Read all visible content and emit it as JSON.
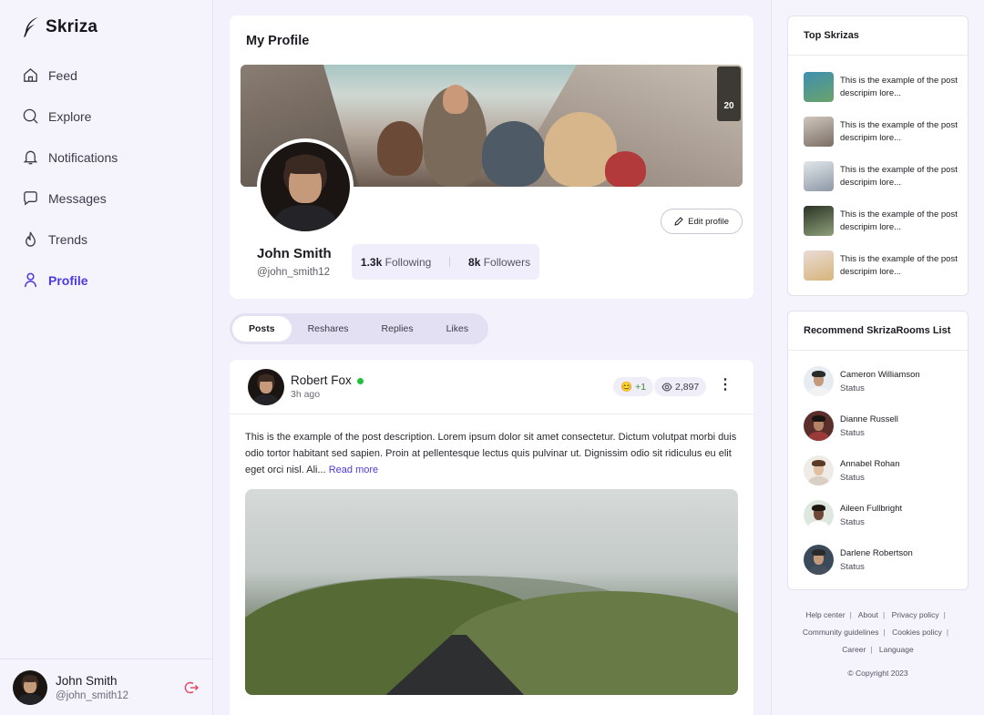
{
  "app": {
    "name": "Skriza"
  },
  "nav": [
    {
      "label": "Feed",
      "icon": "home-icon"
    },
    {
      "label": "Explore",
      "icon": "search-icon"
    },
    {
      "label": "Notifications",
      "icon": "bell-icon"
    },
    {
      "label": "Messages",
      "icon": "message-icon"
    },
    {
      "label": "Trends",
      "icon": "flame-icon"
    },
    {
      "label": "Profile",
      "icon": "user-icon",
      "active": true
    }
  ],
  "current_user": {
    "name": "John Smith",
    "handle": "@john_smith12"
  },
  "profile": {
    "section_title": "My Profile",
    "name": "John Smith",
    "handle": "@john_smith12",
    "edit_label": "Edit profile",
    "following_count": "1.3k",
    "following_label": "Following",
    "followers_count": "8k",
    "followers_label": "Followers",
    "cover_sign": "20"
  },
  "tabs": [
    "Posts",
    "Reshares",
    "Replies",
    "Likes"
  ],
  "post": {
    "author": "Robert Fox",
    "time": "3h ago",
    "reaction": "+1",
    "reaction_emoji": "😊",
    "views": "2,897",
    "text": "This is the example of the post description. Lorem ipsum dolor sit amet consectetur. Dictum volutpat morbi duis odio tortor habitant sed sapien. Proin at pellentesque lectus quis pulvinar ut. Dignissim odio sit ridiculus eu elit eget orci nisl. Ali...",
    "read_more": "Read more"
  },
  "top_skrizas": {
    "title": "Top Skrizas",
    "items": [
      {
        "text": "This is the example of the post descripim lore...",
        "color": "#3f8fb0"
      },
      {
        "text": "This is the example of the post descripim lore...",
        "color": "#9a8f86"
      },
      {
        "text": "This is the example of the post descripim lore...",
        "color": "#b9c2cc"
      },
      {
        "text": "This is the example of the post descripim lore...",
        "color": "#4d5a3a"
      },
      {
        "text": "This is the example of the post descripim lore...",
        "color": "#e0cfc8"
      }
    ]
  },
  "rooms": {
    "title": "Recommend SkrizaRooms List",
    "items": [
      {
        "name": "Cameron Williamson",
        "status": "Status"
      },
      {
        "name": "Dianne Russell",
        "status": "Status"
      },
      {
        "name": "Annabel Rohan",
        "status": "Status"
      },
      {
        "name": "Aileen Fullbright",
        "status": "Status"
      },
      {
        "name": "Darlene Robertson",
        "status": "Status"
      }
    ]
  },
  "footer": {
    "links": [
      "Help center",
      "About",
      "Privacy policy",
      "Community guidelines",
      "Cookies policy",
      "Career",
      "Language"
    ],
    "copyright": "© Copyright 2023"
  }
}
